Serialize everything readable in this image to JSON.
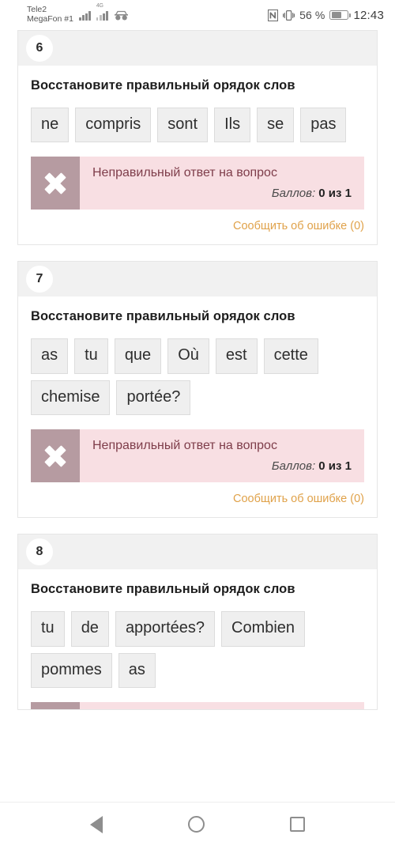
{
  "status_bar": {
    "carrier_line1": "Tele2",
    "carrier_line2": "MegaFon #1",
    "network_label": "4G",
    "battery_percent": "56 %",
    "time": "12:43",
    "icons": [
      "signal-bars-icon",
      "signal-bars-4g-icon",
      "incognito-icon",
      "nfc-icon",
      "vibrate-icon",
      "battery-icon"
    ]
  },
  "questions": [
    {
      "number": "6",
      "prompt": "Восстановите правильный орядок слов",
      "words": [
        "ne",
        "compris",
        "sont",
        "Ils",
        "se",
        "pas"
      ],
      "feedback_title": "Неправильный ответ на вопрос",
      "score_label": "Баллов:",
      "score_value": "0 из 1",
      "report_link": "Сообщить об ошибке (0)"
    },
    {
      "number": "7",
      "prompt": "Восстановите правильный орядок слов",
      "words": [
        "as",
        "tu",
        "que",
        "Où",
        "est",
        "cette",
        "chemise",
        "portée?"
      ],
      "feedback_title": "Неправильный ответ на вопрос",
      "score_label": "Баллов:",
      "score_value": "0 из 1",
      "report_link": "Сообщить об ошибке (0)"
    },
    {
      "number": "8",
      "prompt": "Восстановите правильный орядок слов",
      "words": [
        "tu",
        "de",
        "apportées?",
        "Combien",
        "pommes",
        "as"
      ]
    }
  ],
  "nav_bar": {
    "back": "back-icon",
    "home": "home-icon",
    "recents": "recents-icon"
  },
  "colors": {
    "incorrect_banner_bg": "#f8dfe3",
    "incorrect_icon_bg": "#b69ba1",
    "incorrect_text": "#7e3d4a",
    "report_link": "#e0a24a",
    "chip_bg": "#efefef",
    "card_header_bg": "#f1f1f1"
  }
}
